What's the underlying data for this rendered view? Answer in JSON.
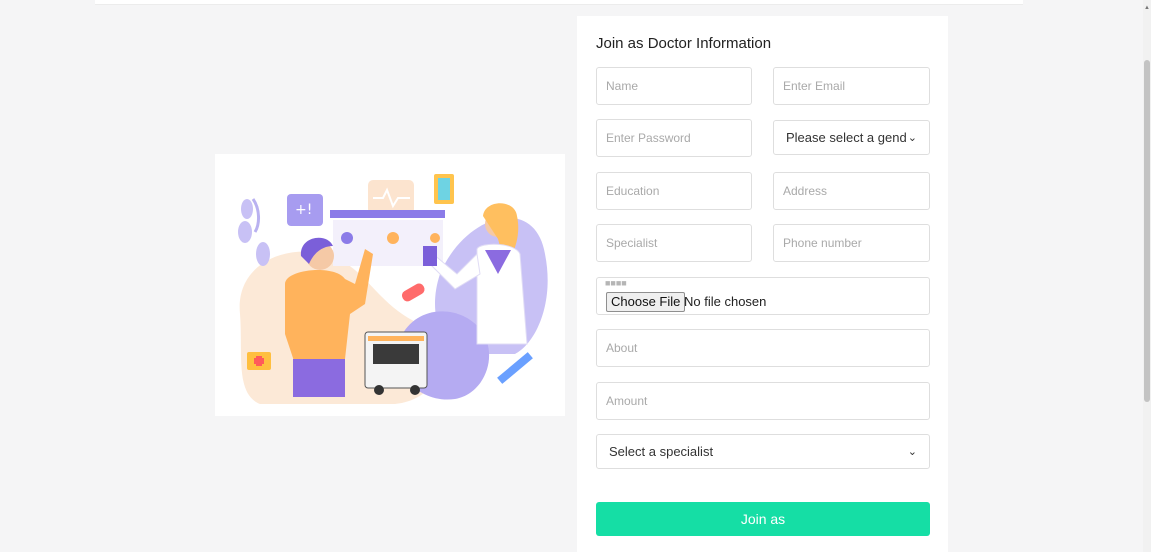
{
  "form": {
    "title": "Join as Doctor Information",
    "fields": {
      "name": {
        "placeholder": "Name"
      },
      "email": {
        "placeholder": "Enter Email"
      },
      "password": {
        "placeholder": "Enter Password"
      },
      "gender": {
        "selected": "Please select a gend"
      },
      "education": {
        "placeholder": "Education"
      },
      "address": {
        "placeholder": "Address"
      },
      "specialist": {
        "placeholder": "Specialist"
      },
      "phone": {
        "placeholder": "Phone number"
      },
      "photo": {
        "button_label": "Choose File",
        "status": "No file chosen"
      },
      "about": {
        "placeholder": "About"
      },
      "amount": {
        "placeholder": "Amount"
      },
      "specialist_select": {
        "selected": "Select a specialist"
      }
    },
    "submit_label": "Join as"
  },
  "colors": {
    "accent": "#15DEA5",
    "illustration_purple": "#8B7BE8",
    "illustration_orange": "#FFB35C",
    "illustration_peach": "#FCE9D7"
  },
  "icons": {
    "dropdown": "chevron-down-icon"
  }
}
